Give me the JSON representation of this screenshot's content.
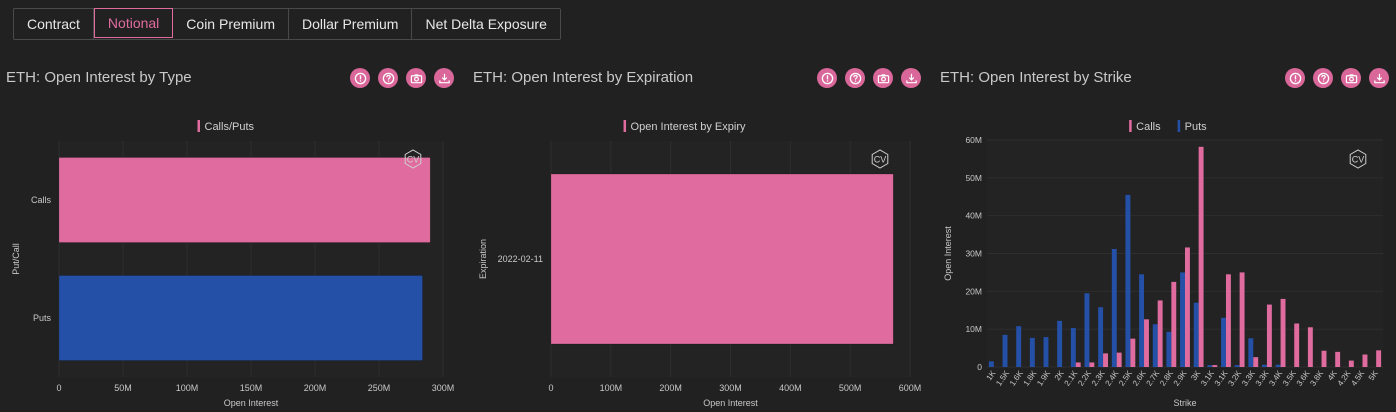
{
  "tabs": [
    {
      "label": "Contract",
      "active": false
    },
    {
      "label": "Notional",
      "active": true
    },
    {
      "label": "Coin Premium",
      "active": false
    },
    {
      "label": "Dollar Premium",
      "active": false
    },
    {
      "label": "Net Delta Exposure",
      "active": false
    }
  ],
  "colors": {
    "pink": "#e06c9f",
    "blue": "#2450a8",
    "bg": "#212121",
    "grid": "#2e2e2e"
  },
  "watermark": "CV",
  "panels": [
    {
      "title": "ETH: Open Interest by Type",
      "icons": [
        "info-icon",
        "help-icon",
        "camera-icon",
        "download-icon"
      ]
    },
    {
      "title": "ETH: Open Interest by Expiration",
      "icons": [
        "info-icon",
        "help-icon",
        "camera-icon",
        "download-icon"
      ]
    },
    {
      "title": "ETH: Open Interest by Strike",
      "icons": [
        "info-icon",
        "help-icon",
        "camera-icon",
        "download-icon"
      ]
    }
  ],
  "chart_data": [
    {
      "type": "bar",
      "orientation": "horizontal",
      "legend": [
        "Calls/Puts"
      ],
      "categories": [
        "Calls",
        "Puts"
      ],
      "values": [
        290000000,
        284000000
      ],
      "bar_colors": [
        "#e06c9f",
        "#2450a8"
      ],
      "xlabel": "Open Interest",
      "ylabel": "Put/Call",
      "xlim": [
        0,
        300000000
      ],
      "xticks": [
        "0",
        "50M",
        "100M",
        "150M",
        "200M",
        "250M",
        "300M"
      ]
    },
    {
      "type": "bar",
      "orientation": "horizontal",
      "legend": [
        "Open Interest by Expiry"
      ],
      "categories": [
        "2022-02-11"
      ],
      "values": [
        572000000
      ],
      "xlabel": "Open Interest",
      "ylabel": "Expiration",
      "xlim": [
        0,
        600000000
      ],
      "xticks": [
        "0",
        "100M",
        "200M",
        "300M",
        "400M",
        "500M",
        "600M"
      ]
    },
    {
      "type": "bar",
      "orientation": "vertical",
      "legend": [
        "Calls",
        "Puts"
      ],
      "categories": [
        "1K",
        "1.5K",
        "1.6K",
        "1.8K",
        "1.9K",
        "2K",
        "2.1K",
        "2.2K",
        "2.3K",
        "2.4K",
        "2.5K",
        "2.6K",
        "2.7K",
        "2.8K",
        "2.9K",
        "3K",
        "3.1K",
        "3.2K",
        "3.3K",
        "3.4K",
        "3.5K",
        "3.6K",
        "3.8K",
        "4K",
        "4.2K",
        "4.5K",
        "5K"
      ],
      "series": [
        {
          "name": "Calls",
          "values": [
            0,
            0,
            0,
            0,
            0,
            0,
            1.2,
            1.2,
            3.6,
            3.8,
            7.5,
            12.6,
            17.6,
            22.5,
            31.6,
            58.2,
            0.5,
            24.5,
            25,
            2.6,
            16.5,
            18,
            11.5,
            10.5,
            4.3,
            4,
            1.7,
            3.3,
            4.4
          ]
        },
        {
          "name": "Puts",
          "values": [
            1.5,
            8.5,
            10.8,
            7.7,
            7.9,
            12.2,
            10.3,
            19.5,
            15.8,
            31.2,
            45.5,
            24.5,
            11.3,
            9.3,
            25,
            17,
            0.5,
            13,
            0.5,
            7.6,
            0.6,
            0.6,
            0,
            0,
            0,
            0,
            0,
            0,
            0
          ]
        }
      ],
      "xticks": [
        "1K",
        "1.5K",
        "1.6K",
        "1.8K",
        "1.9K",
        "2K",
        "2.1K",
        "2.2K",
        "2.3K",
        "2.4K",
        "2.5K",
        "2.6K",
        "2.7K",
        "2.8K",
        "2.9K",
        "3K",
        "3.1K",
        "3.1K",
        "3.2K",
        "3.3K",
        "3.3K",
        "3.4K",
        "3.5K",
        "3.6K",
        "3.8K",
        "4K",
        "4.2K",
        "4.5K",
        "5K"
      ],
      "xlabel": "Strike",
      "ylabel": "Open Interest",
      "ylim": [
        0,
        60
      ],
      "yticks": [
        "0",
        "10M",
        "20M",
        "30M",
        "40M",
        "50M",
        "60M"
      ]
    }
  ]
}
